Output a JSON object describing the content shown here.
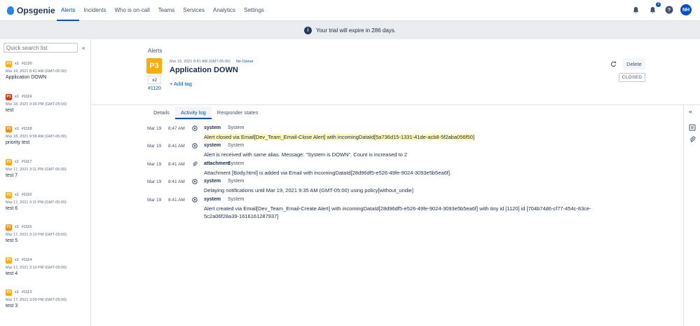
{
  "app": {
    "logo_text": "Opsgenie",
    "brand_color": "#2684ff"
  },
  "nav": {
    "items": [
      "Alerts",
      "Incidents",
      "Who is on-call",
      "Teams",
      "Services",
      "Analytics",
      "Settings"
    ],
    "active": "Alerts"
  },
  "topright": {
    "notif_count": "3",
    "avatar": "NH"
  },
  "banner": {
    "text": "Your trial will expire in 286 days."
  },
  "sidebar": {
    "search_placeholder": "Quick search list",
    "items": [
      {
        "priority": "P3",
        "count": "x1",
        "number": "#1120",
        "date": "Mar 19, 2021 8:41 AM (GMT-05:00)",
        "message": "Application DOWN"
      },
      {
        "priority": "P1",
        "count": "x1",
        "number": "#1119",
        "date": "Mar 18, 2021 3:35 PM (GMT-05:00)",
        "message": "test"
      },
      {
        "priority": "P2",
        "count": "x1",
        "number": "#1118",
        "date": "Mar 18, 2021 9:58 AM (GMT-05:00)",
        "message": "priority test"
      },
      {
        "priority": "P3",
        "count": "x1",
        "number": "#1117",
        "date": "Mar 17, 2021 3:11 PM (GMT-05:00)",
        "message": "test 7"
      },
      {
        "priority": "P3",
        "count": "x1",
        "number": "#1116",
        "date": "Mar 17, 2021 3:11 PM (GMT-05:00)",
        "message": "test 6"
      },
      {
        "priority": "P2",
        "count": "x1",
        "number": "#1115",
        "date": "Mar 17, 2021 3:10 PM (GMT-05:00)",
        "message": "test 5"
      },
      {
        "priority": "P3",
        "count": "x1",
        "number": "#1114",
        "date": "Mar 17, 2021 3:10 PM (GMT-05:00)",
        "message": "test 4"
      },
      {
        "priority": "P3",
        "count": "x1",
        "number": "#1113",
        "date": "Mar 17, 2021 3:09 PM (GMT-05:00)",
        "message": "test 3"
      }
    ]
  },
  "alert": {
    "breadcrumb": "Alerts",
    "priority": "P3",
    "count": "x2",
    "tiny_number": "#1120",
    "date": "Mar 19, 2021 8:41 AM (GMT-05:00)",
    "owner": "No Owner",
    "title": "Application DOWN",
    "add_tag": "+ Add tag",
    "delete_label": "Delete",
    "status": "CLOSED"
  },
  "tabs": [
    "Details",
    "Activity log",
    "Responder states"
  ],
  "active_tab": "Activity log",
  "log": [
    {
      "date": "Mar 19",
      "time": "8:47 AM",
      "who": "system",
      "source": "System",
      "message": "Alert closed via Email[Dev_Team_Email-Close Alert] with incomingDataId[5a736d15-1331-41de-acb8-5f2aba056f50]",
      "highlight": true,
      "icon": "gear-icon"
    },
    {
      "date": "Mar 19",
      "time": "8:41 AM",
      "who": "system",
      "source": "System",
      "message": "Alert is received with same alias. Message: \"System is DOWN\". Count is increased to 2",
      "highlight": false,
      "icon": "gear-icon"
    },
    {
      "date": "Mar 19",
      "time": "8:41 AM",
      "who": "attachment",
      "source": "System",
      "message": "Attachment [Body.html] is added via Email with incomingDataId[28d96df5-e526-49fe-9024-3093e5b5ea6f].",
      "highlight": false,
      "icon": "paperclip-icon"
    },
    {
      "date": "Mar 19",
      "time": "8:41 AM",
      "who": "system",
      "source": "System",
      "message": "Delaying notifications until Mar 19, 2021 9:35 AM (GMT-05:00) using policy[without_undie]",
      "highlight": false,
      "icon": "gear-icon"
    },
    {
      "date": "Mar 19",
      "time": "8:41 AM",
      "who": "system",
      "source": "System",
      "message": "Alert created via Email[Dev_Team_Email-Create Alert] with incomingDataId[28d96df5-e526-49fe-9024-3093e5b5ea6f] with tiny id [1120] id [704b74d6-cf77-454c-83ce-5c2a06f28a39-1616161287937]",
      "highlight": false,
      "icon": "gear-icon"
    }
  ]
}
